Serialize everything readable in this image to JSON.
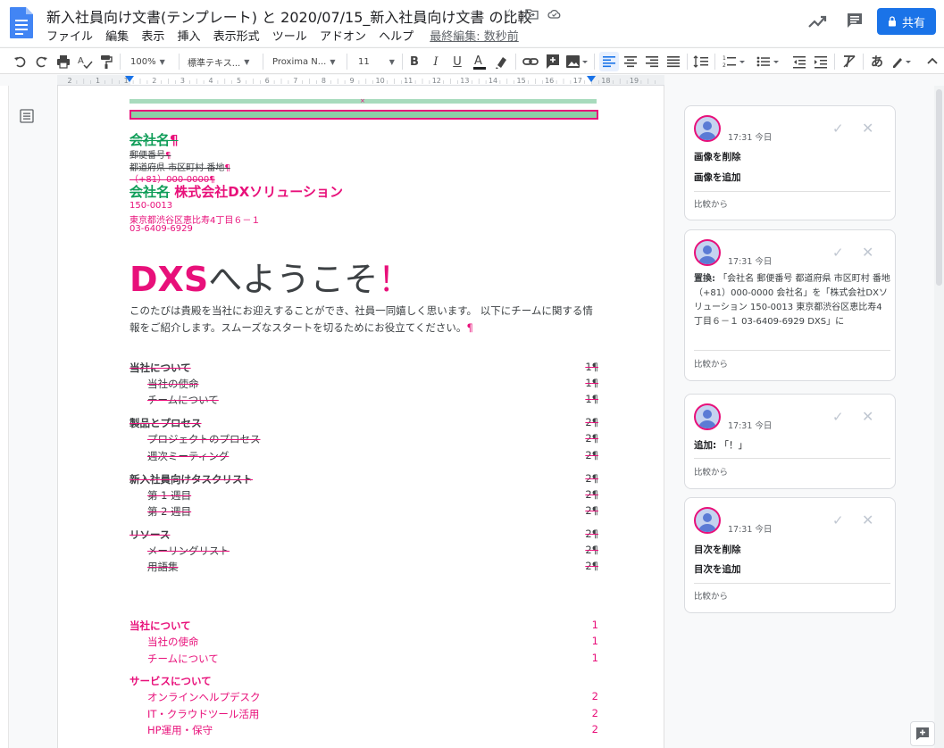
{
  "header": {
    "title": "新入社員向け文書(テンプレート) と 2020/07/15_新入社員向け文書 の比較",
    "menu": [
      "ファイル",
      "編集",
      "表示",
      "挿入",
      "表示形式",
      "ツール",
      "アドオン",
      "ヘルプ"
    ],
    "last_edit": "最終編集: 数秒前",
    "share_label": "共有"
  },
  "toolbar": {
    "zoom": "100%",
    "style": "標準テキス...",
    "font": "Proxima N...",
    "size": "11",
    "input_mode": "あ"
  },
  "ruler": {
    "ticks": [
      "2",
      "1",
      "1",
      "2",
      "3",
      "4",
      "5",
      "6",
      "7",
      "8",
      "9",
      "10",
      "11",
      "12",
      "13",
      "14",
      "15",
      "16",
      "17",
      "18",
      "19"
    ]
  },
  "document": {
    "old_company": "会社名",
    "old_postal": "郵便番号",
    "old_address": "都道府県 市区町村 番地",
    "old_phone": "（+81）000-0000",
    "new_company_old": "会社名",
    "new_company": "株式会社DXソリューション",
    "new_postal": "150-0013",
    "new_address": "東京都渋谷区恵比寿4丁目６－１",
    "new_phone": "03-6409-6929",
    "heading_brand": "DXS",
    "heading_rest": "へようこそ",
    "heading_bang": "！",
    "intro": "このたびは貴殿を当社にお迎えすることができ、社員一同嬉しく思います。 以下にチームに関する情報をご紹介します。スムーズなスタートを切るためにお役立てください。",
    "pilcrow": "¶",
    "toc_old": [
      {
        "label": "当社について",
        "page": "1"
      },
      {
        "label": "当社の使命",
        "page": "1"
      },
      {
        "label": "チームについて",
        "page": "1"
      },
      {
        "label": "製品とプロセス",
        "page": "2"
      },
      {
        "label": "プロジェクトのプロセス",
        "page": "2"
      },
      {
        "label": "週次ミーティング",
        "page": "2"
      },
      {
        "label": "新入社員向けタスクリスト",
        "page": "2"
      },
      {
        "label": "第 1 週目",
        "page": "2"
      },
      {
        "label": "第 2 週目",
        "page": "2"
      },
      {
        "label": "リソース",
        "page": "2"
      },
      {
        "label": "メーリングリスト",
        "page": "2"
      },
      {
        "label": "用語集",
        "page": "2"
      }
    ],
    "toc_new": [
      {
        "label": "当社について",
        "page": "1"
      },
      {
        "label": "当社の使命",
        "page": "1"
      },
      {
        "label": "チームについて",
        "page": "1"
      },
      {
        "label": "サービスについて",
        "page": "2"
      },
      {
        "label": "オンラインヘルプデスク",
        "page": "2"
      },
      {
        "label": "IT・クラウドツール活用",
        "page": "2"
      },
      {
        "label": "HP運用・保守",
        "page": "2"
      }
    ]
  },
  "suggestions": [
    {
      "time": "17:31 今日",
      "line1": "画像を削除",
      "line2": "画像を追加",
      "from": "比較から"
    },
    {
      "time": "17:31 今日",
      "action": "置換:",
      "desc": "「会社名 郵便番号 都道府県 市区町村 番地 （+81）000-0000 会社名」を「株式会社DXソリューション 150-0013 東京都渋谷区恵比寿4丁目６－１ 03-6409-6929 DXS」に",
      "from": "比較から"
    },
    {
      "time": "17:31 今日",
      "action": "追加:",
      "value": "「！」",
      "from": "比較から"
    },
    {
      "time": "17:31 今日",
      "line1": "目次を削除",
      "line2": "目次を追加",
      "from": "比較から"
    }
  ],
  "colors": {
    "accent": "#e8107a",
    "deleted_heading": "#0f9d58",
    "share_blue": "#1a73e8"
  }
}
